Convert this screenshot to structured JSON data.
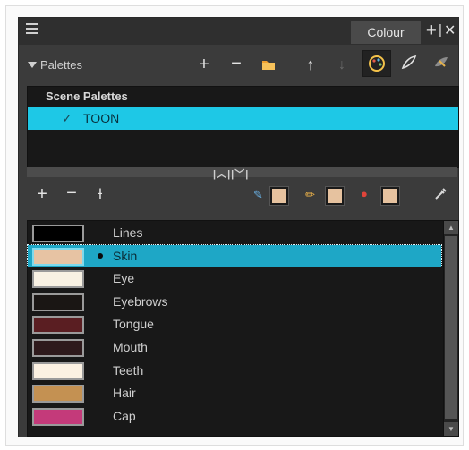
{
  "window": {
    "tab_label": "Colour"
  },
  "palettes_section": {
    "label": "Palettes"
  },
  "palette_list": {
    "group_title": "Scene Palettes",
    "items": [
      {
        "label": "TOON",
        "checked": true,
        "check_glyph": "✓"
      }
    ]
  },
  "colours": [
    {
      "name": "Lines",
      "color": "#000000",
      "selected": false
    },
    {
      "name": "Skin",
      "color": "#e7c3a3",
      "selected": true
    },
    {
      "name": "Eye",
      "color": "#f8f1e3",
      "selected": false
    },
    {
      "name": "Eyebrows",
      "color": "#1a1614",
      "selected": false
    },
    {
      "name": "Tongue",
      "color": "#5a1e22",
      "selected": false
    },
    {
      "name": "Mouth",
      "color": "#2e1a1c",
      "selected": false
    },
    {
      "name": "Teeth",
      "color": "#fbf1e2",
      "selected": false
    },
    {
      "name": "Hair",
      "color": "#c49152",
      "selected": false
    },
    {
      "name": "Cap",
      "color": "#c43a7a",
      "selected": false
    }
  ],
  "colors": {
    "selection": "#1ec8e6",
    "list_selection": "#1ea7c6",
    "current_swatch": "#e6c29f"
  },
  "icons": {
    "menu": "hamburger-icon",
    "add": "plus-icon",
    "remove": "minus-icon",
    "import": "folder-icon",
    "move_up": "arrow-up-icon",
    "move_down": "arrow-down-icon",
    "paint_mode": "paint-palette-icon",
    "stroke_mode": "brush-icon",
    "texture_mode": "texture-icon",
    "add_texture": "texture-add-icon",
    "brush": "brush-colour-icon",
    "pencil": "pencil-colour-icon",
    "paint_bucket": "paint-bucket-icon",
    "eyedropper": "eyedropper-icon",
    "close": "close-icon",
    "add_tab": "add-tab-icon"
  }
}
